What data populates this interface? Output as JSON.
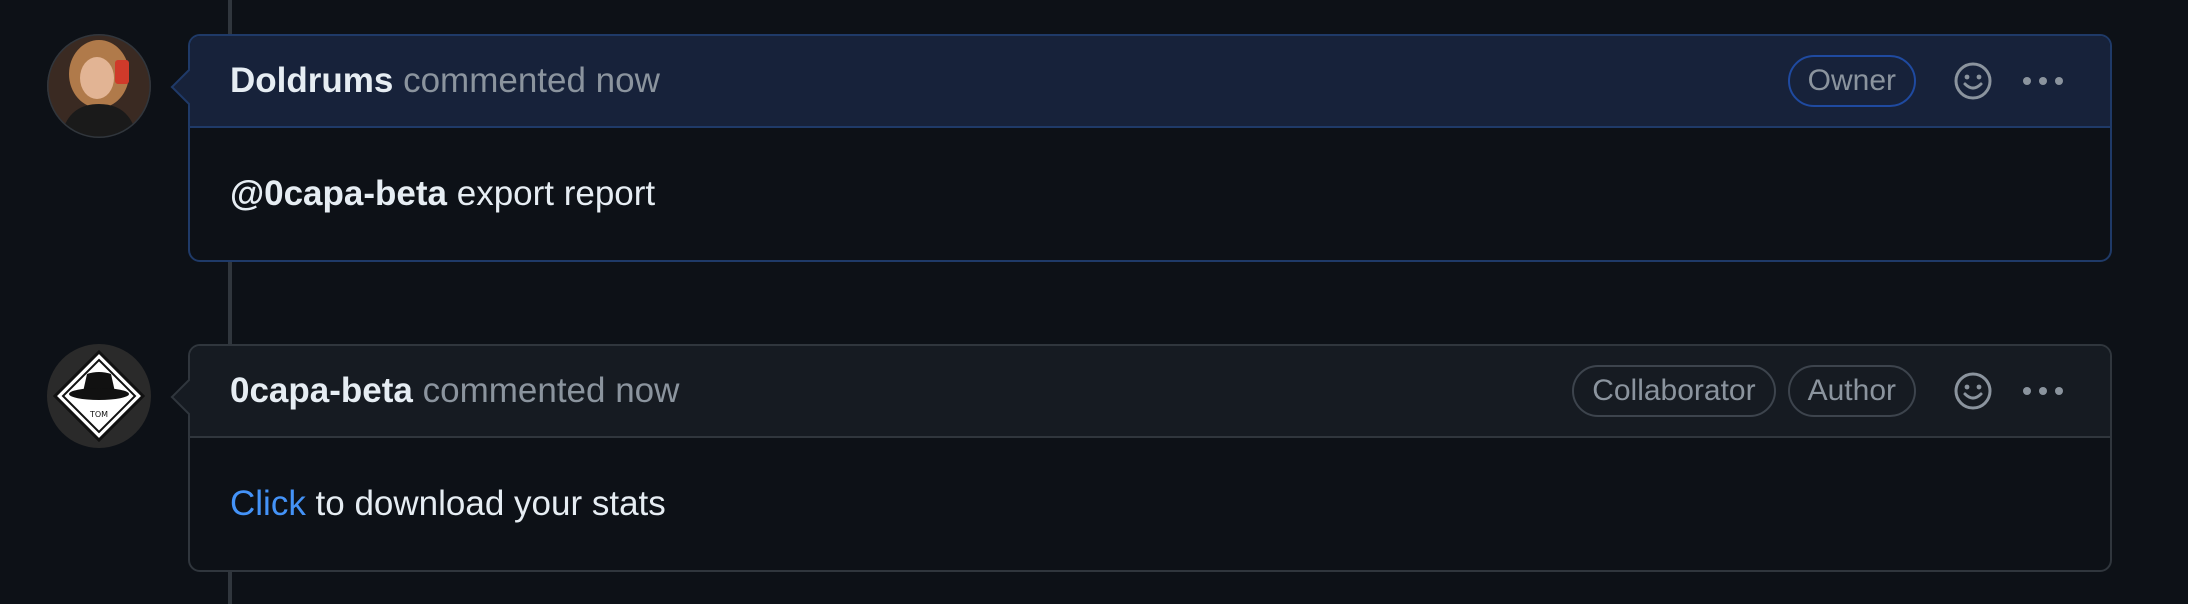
{
  "comments": [
    {
      "author": "Doldrums",
      "action": "commented now",
      "badges": [
        "Owner"
      ],
      "body": {
        "mention": "@0capa-beta",
        "text": " export report"
      }
    },
    {
      "author": "0capa-beta",
      "action": "commented now",
      "badges": [
        "Collaborator",
        "Author"
      ],
      "avatar_label": "TOM",
      "body": {
        "link": "Click",
        "text": " to download your stats"
      }
    }
  ],
  "icons": {
    "reaction": "smiley-icon",
    "more": "kebab-horizontal-icon"
  },
  "colors": {
    "background": "#0d1117",
    "owner_header": "#17223a",
    "owner_border": "#1f3a68",
    "link": "#4493f8"
  }
}
